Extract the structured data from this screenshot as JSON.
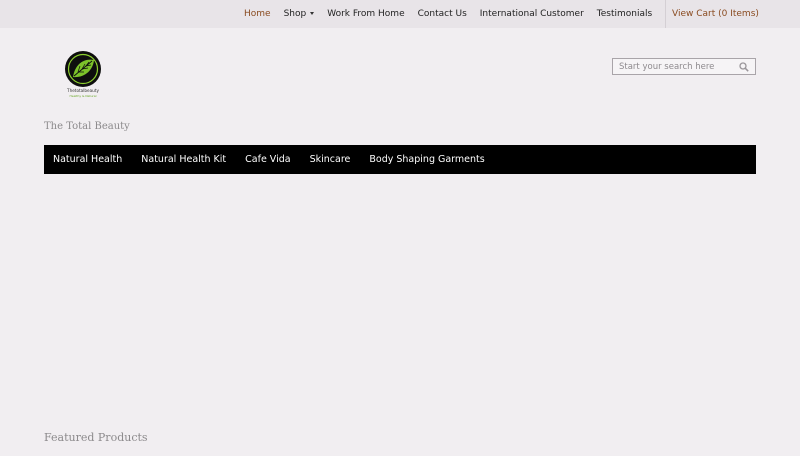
{
  "topnav": {
    "items": [
      {
        "label": "Home",
        "active": true
      },
      {
        "label": "Shop",
        "has_dropdown": true
      },
      {
        "label": "Work From Home"
      },
      {
        "label": "Contact Us"
      },
      {
        "label": "International Customer"
      },
      {
        "label": "Testimonials"
      }
    ],
    "cart_label": "View Cart (0 Items)"
  },
  "logo": {
    "icon": "leaf-logo-icon",
    "text": "Thetotalbeauty",
    "subtext": "Healthy & Natural"
  },
  "search": {
    "placeholder": "Start your search here",
    "icon": "search-icon"
  },
  "tagline": "The Total Beauty",
  "mainnav": {
    "items": [
      {
        "label": "Natural Health"
      },
      {
        "label": "Natural Health Kit"
      },
      {
        "label": "Cafe Vida"
      },
      {
        "label": "Skincare"
      },
      {
        "label": "Body Shaping Garments"
      }
    ]
  },
  "featured_heading": "Featured Products",
  "colors": {
    "accent": "#8a4b20",
    "nav_bg": "#000000",
    "page_bg": "#f1eef1",
    "topbar_bg": "#e8e4e8"
  }
}
